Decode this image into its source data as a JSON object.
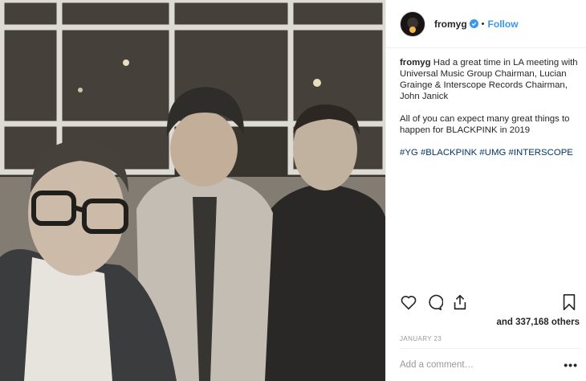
{
  "post": {
    "photo_icon": "group-photo-image",
    "username": "fromyg",
    "verified_icon": "verified-badge-icon",
    "separator": "•",
    "follow_label": "Follow",
    "caption": {
      "username": "fromyg",
      "text": "Had a great time in LA meeting with Universal Music Group Chairman, Lucian Grainge & Interscope Records Chairman, John Janick",
      "second_paragraph": "All of you can expect many great things to happen for BLACKPINK in 2019",
      "hashtags": [
        "#YG",
        "#BLACKPINK",
        "#UMG",
        "#INTERSCOPE"
      ]
    },
    "actions": {
      "like_icon": "heart-icon",
      "comment_icon": "comment-icon",
      "share_icon": "share-icon",
      "save_icon": "bookmark-icon"
    },
    "likes_text": "and 337,168 others",
    "date": "JANUARY 23",
    "comment_placeholder": "Add a comment…",
    "more_label": "•••",
    "accent_color": "#3897f0"
  }
}
